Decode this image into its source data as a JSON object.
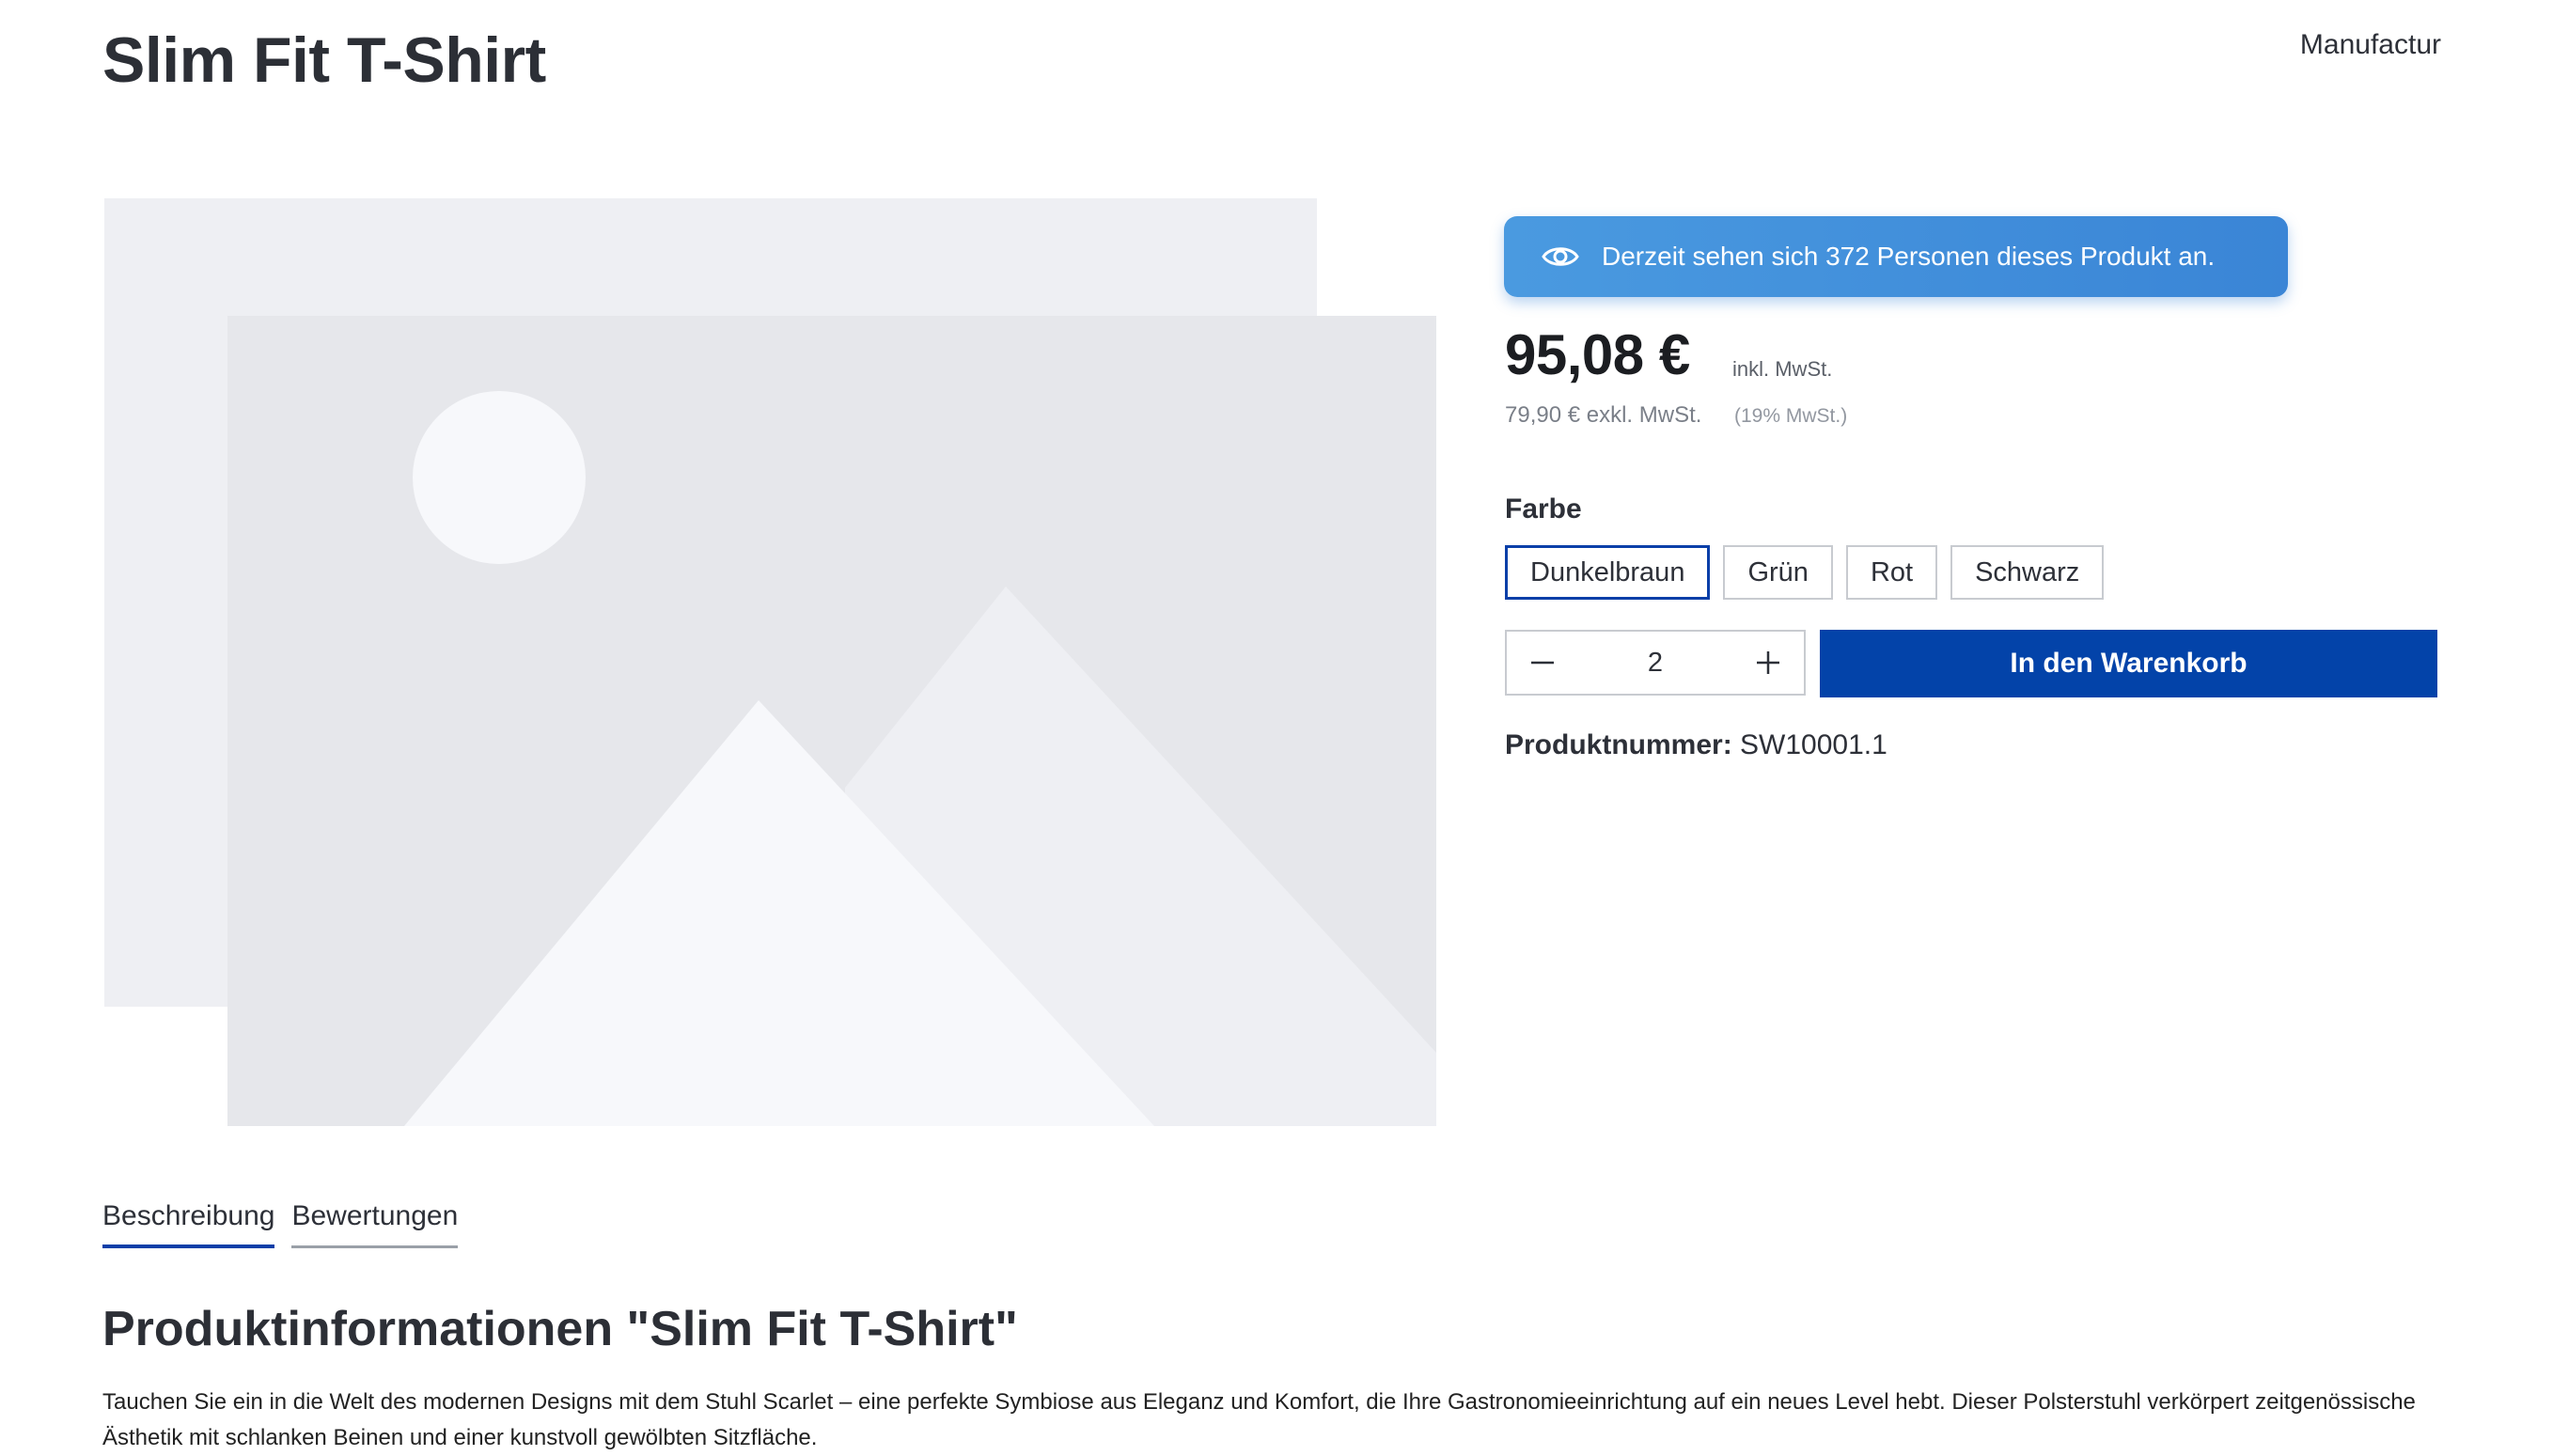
{
  "product": {
    "title": "Slim Fit T-Shirt",
    "manufacturer": "Manufactur"
  },
  "buy_box": {
    "viewers_notice": "Derzeit sehen sich 372 Personen dieses Produkt an.",
    "price": "95,08 €",
    "price_incl_label": "inkl. MwSt.",
    "net_price": "79,90 € exkl. MwSt.",
    "vat_note": "(19% MwSt.)",
    "color_label": "Farbe",
    "colors": [
      "Dunkelbraun",
      "Grün",
      "Rot",
      "Schwarz"
    ],
    "selected_color": "Dunkelbraun",
    "quantity": "2",
    "add_to_cart_label": "In den Warenkorb",
    "product_number_label": "Produktnummer:",
    "product_number": "SW10001.1"
  },
  "tabs": [
    "Beschreibung",
    "Bewertungen"
  ],
  "active_tab": "Beschreibung",
  "description": {
    "heading": "Produktinformationen \"Slim Fit T-Shirt\"",
    "text": "Tauchen Sie ein in die Welt des modernen Designs mit dem Stuhl Scarlet – eine perfekte Symbiose aus Eleganz und Komfort, die Ihre Gastronomieeinrichtung auf ein neues Level hebt. Dieser Polsterstuhl verkörpert zeitgenössische Ästhetik mit schlanken Beinen und einer kunstvoll gewölbten Sitzfläche."
  },
  "icons": {
    "viewers": "eye-icon",
    "decrease": "minus-icon",
    "increase": "plus-icon",
    "image": "image-placeholder"
  },
  "colors": {
    "accent": "#0343a9",
    "badge": "#3a85d6",
    "placeholder_back": "#eeeff3",
    "placeholder_front": "#e6e7eb",
    "placeholder_shape": "#f7f8fb"
  }
}
